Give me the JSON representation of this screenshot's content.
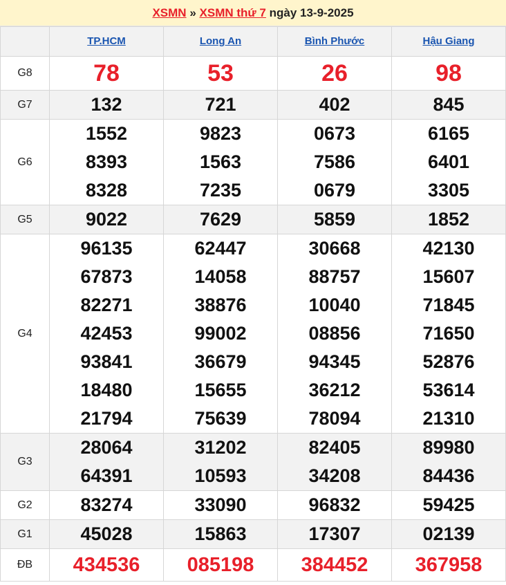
{
  "header": {
    "link1": "XSMN",
    "sep": "»",
    "link2": "XSMN thứ 7",
    "date_text": "ngày 13-9-2025"
  },
  "provinces": [
    "TP.HCM",
    "Long An",
    "Bình Phước",
    "Hậu Giang"
  ],
  "colors": {
    "red": "#e8202a",
    "link_blue": "#1a55b0",
    "header_bg": "#fff5cc",
    "alt_row": "#f2f2f2"
  },
  "prizes": [
    {
      "label": "G8",
      "style": "big",
      "alt": false,
      "cols": [
        [
          "78"
        ],
        [
          "53"
        ],
        [
          "26"
        ],
        [
          "98"
        ]
      ]
    },
    {
      "label": "G7",
      "style": "normal",
      "alt": true,
      "cols": [
        [
          "132"
        ],
        [
          "721"
        ],
        [
          "402"
        ],
        [
          "845"
        ]
      ]
    },
    {
      "label": "G6",
      "style": "normal",
      "alt": false,
      "cols": [
        [
          "1552",
          "8393",
          "8328"
        ],
        [
          "9823",
          "1563",
          "7235"
        ],
        [
          "0673",
          "7586",
          "0679"
        ],
        [
          "6165",
          "6401",
          "3305"
        ]
      ]
    },
    {
      "label": "G5",
      "style": "normal",
      "alt": true,
      "cols": [
        [
          "9022"
        ],
        [
          "7629"
        ],
        [
          "5859"
        ],
        [
          "1852"
        ]
      ]
    },
    {
      "label": "G4",
      "style": "normal",
      "alt": false,
      "cols": [
        [
          "96135",
          "67873",
          "82271",
          "42453",
          "93841",
          "18480",
          "21794"
        ],
        [
          "62447",
          "14058",
          "38876",
          "99002",
          "36679",
          "15655",
          "75639"
        ],
        [
          "30668",
          "88757",
          "10040",
          "08856",
          "94345",
          "36212",
          "78094"
        ],
        [
          "42130",
          "15607",
          "71845",
          "71650",
          "52876",
          "53614",
          "21310"
        ]
      ]
    },
    {
      "label": "G3",
      "style": "normal",
      "alt": true,
      "cols": [
        [
          "28064",
          "64391"
        ],
        [
          "31202",
          "10593"
        ],
        [
          "82405",
          "34208"
        ],
        [
          "89980",
          "84436"
        ]
      ]
    },
    {
      "label": "G2",
      "style": "normal",
      "alt": false,
      "cols": [
        [
          "83274"
        ],
        [
          "33090"
        ],
        [
          "96832"
        ],
        [
          "59425"
        ]
      ]
    },
    {
      "label": "G1",
      "style": "normal",
      "alt": true,
      "cols": [
        [
          "45028"
        ],
        [
          "15863"
        ],
        [
          "17307"
        ],
        [
          "02139"
        ]
      ]
    },
    {
      "label": "ĐB",
      "style": "db",
      "alt": false,
      "cols": [
        [
          "434536"
        ],
        [
          "085198"
        ],
        [
          "384452"
        ],
        [
          "367958"
        ]
      ]
    }
  ]
}
